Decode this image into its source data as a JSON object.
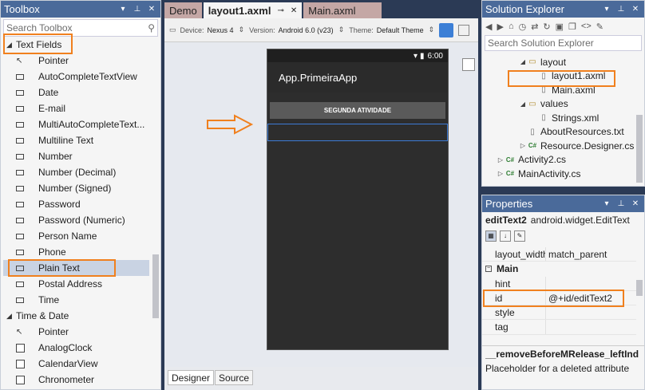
{
  "toolbox": {
    "title": "Toolbox",
    "search_placeholder": "Search Toolbox",
    "categories": [
      {
        "label": "Text Fields",
        "items": [
          {
            "label": "Pointer",
            "icon": "pointer-icon"
          },
          {
            "label": "AutoCompleteTextView",
            "icon": "textbox-icon"
          },
          {
            "label": "Date",
            "icon": "textbox-icon"
          },
          {
            "label": "E-mail",
            "icon": "textbox-icon"
          },
          {
            "label": "MultiAutoCompleteText...",
            "icon": "textbox-icon"
          },
          {
            "label": "Multiline Text",
            "icon": "textbox-icon"
          },
          {
            "label": "Number",
            "icon": "textbox-icon"
          },
          {
            "label": "Number (Decimal)",
            "icon": "textbox-icon"
          },
          {
            "label": "Number (Signed)",
            "icon": "textbox-icon"
          },
          {
            "label": "Password",
            "icon": "textbox-icon"
          },
          {
            "label": "Password (Numeric)",
            "icon": "textbox-icon"
          },
          {
            "label": "Person Name",
            "icon": "textbox-icon"
          },
          {
            "label": "Phone",
            "icon": "textbox-icon"
          },
          {
            "label": "Plain Text",
            "icon": "textbox-icon",
            "selected": true
          },
          {
            "label": "Postal Address",
            "icon": "textbox-icon"
          },
          {
            "label": "Time",
            "icon": "textbox-icon"
          }
        ]
      },
      {
        "label": "Time & Date",
        "items": [
          {
            "label": "Pointer",
            "icon": "pointer-icon"
          },
          {
            "label": "AnalogClock",
            "icon": "checkbox-icon"
          },
          {
            "label": "CalendarView",
            "icon": "checkbox-icon"
          },
          {
            "label": "Chronometer",
            "icon": "checkbox-icon"
          }
        ]
      }
    ]
  },
  "editor": {
    "tabs": [
      {
        "label": "Demo"
      },
      {
        "label": "layout1.axml"
      },
      {
        "label": "Main.axml"
      }
    ],
    "device_label": "Device:",
    "device_value": "Nexus 4",
    "version_label": "Version:",
    "version_value": "Android 6.0 (v23)",
    "theme_label": "Theme:",
    "theme_value": "Default Theme",
    "phone": {
      "time": "6:00",
      "app_title": "App.PrimeiraApp",
      "button_text": "SEGUNDA ATIVIDADE"
    },
    "bottom_tabs": {
      "designer": "Designer",
      "source": "Source"
    }
  },
  "solution_explorer": {
    "title": "Solution Explorer",
    "search_placeholder": "Search Solution Explorer",
    "tree": [
      {
        "label": "layout",
        "type": "folder",
        "indent": 3,
        "expanded": true
      },
      {
        "label": "layout1.axml",
        "type": "file",
        "indent": 4
      },
      {
        "label": "Main.axml",
        "type": "file",
        "indent": 4
      },
      {
        "label": "values",
        "type": "folder",
        "indent": 3,
        "expanded": true
      },
      {
        "label": "Strings.xml",
        "type": "file",
        "indent": 4
      },
      {
        "label": "AboutResources.txt",
        "type": "file",
        "indent": 3
      },
      {
        "label": "Resource.Designer.cs",
        "type": "cs",
        "indent": 3,
        "collapsed": true
      },
      {
        "label": "Activity2.cs",
        "type": "cs",
        "indent": 1,
        "collapsed": true
      },
      {
        "label": "MainActivity.cs",
        "type": "cs",
        "indent": 1,
        "collapsed": true
      }
    ]
  },
  "properties": {
    "title": "Properties",
    "target_name": "editText2",
    "target_type": "android.widget.EditText",
    "rows_top": [
      {
        "key": "layout_width",
        "value": "match_parent"
      }
    ],
    "section": "Main",
    "rows": [
      {
        "key": "hint",
        "value": ""
      },
      {
        "key": "id",
        "value": "@+id/editText2"
      },
      {
        "key": "style",
        "value": ""
      },
      {
        "key": "tag",
        "value": ""
      }
    ],
    "desc_title": "__removeBeforeMRelease_leftInd",
    "desc_text": "Placeholder for a deleted attribute"
  },
  "colors": {
    "panel_header": "#4a6a9a",
    "highlight": "#f0801e",
    "selection": "#c9d3e3"
  }
}
